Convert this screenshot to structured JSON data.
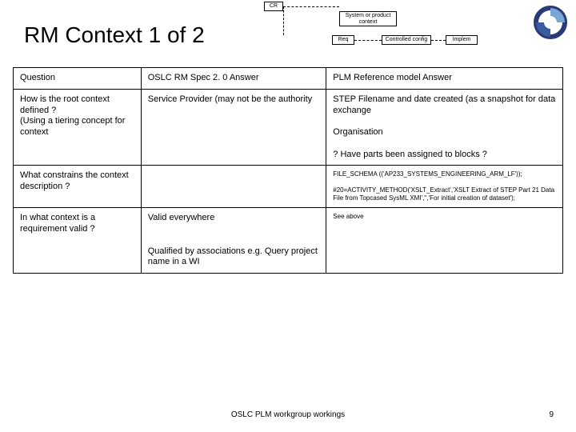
{
  "title": "RM Context 1 of 2",
  "diagram": {
    "cr": "CR",
    "sys": "System or product context",
    "req": "Req",
    "cc": "Controlled config",
    "impl": "Implem"
  },
  "table": {
    "header": {
      "c1": "Question",
      "c2": "OSLC RM Spec 2. 0 Answer",
      "c3": "PLM Reference model Answer"
    },
    "r1": {
      "c1a": "How is the root context defined ?",
      "c1b": "(Using a tiering concept for context",
      "c2": "Service Provider (may not be the authority",
      "c3a": "STEP Filename and date created (as a snapshot for data exchange",
      "c3b": "Organisation",
      "c3c": "? Have parts been assigned to blocks ?"
    },
    "r2": {
      "c1": "What constrains the context description ?",
      "c3a": "FILE_SCHEMA (('AP233_SYSTEMS_ENGINEERING_ARM_LF'));",
      "c3b": "#20=ACTIVITY_METHOD('XSLT_Extract','XSLT Extract of STEP Part 21 Data File from Topcased SysML XMI','','For initial creation of dataset');"
    },
    "r3": {
      "c1": "In what context is a requirement valid ?",
      "c2a": "Valid everywhere",
      "c2b": "Qualified by associations e.g. Query project name in a WI",
      "c3": "See above"
    }
  },
  "footer": {
    "center": "OSLC PLM workgroup workings",
    "page": "9"
  }
}
